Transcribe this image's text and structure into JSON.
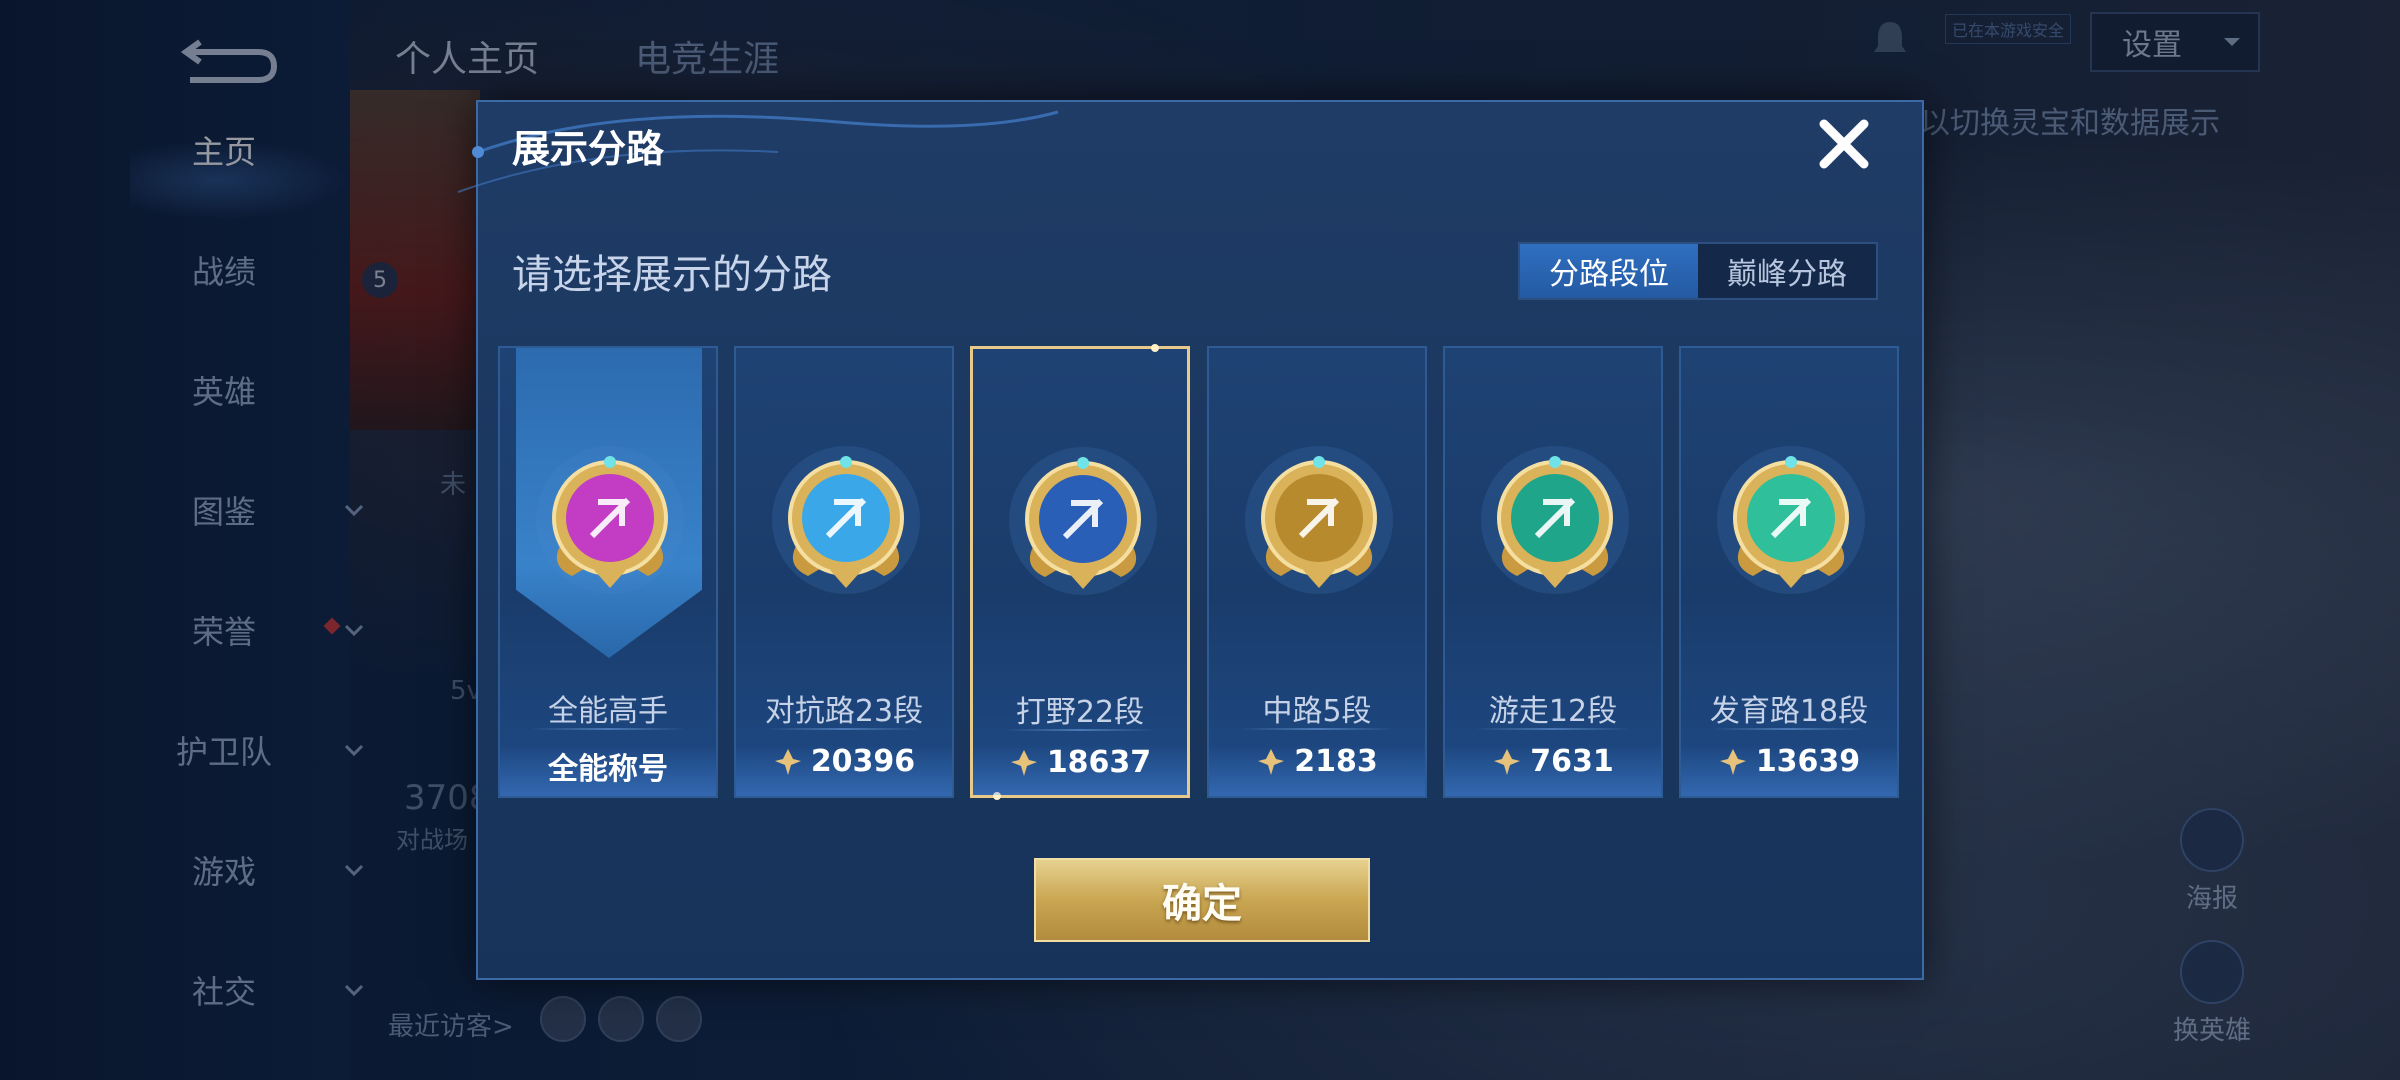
{
  "left_nav": {
    "items": [
      {
        "label": "主页",
        "active": true,
        "chevron": false
      },
      {
        "label": "战绩",
        "active": false,
        "chevron": false
      },
      {
        "label": "英雄",
        "active": false,
        "chevron": false
      },
      {
        "label": "图鉴",
        "active": false,
        "chevron": true
      },
      {
        "label": "荣誉",
        "active": false,
        "chevron": true
      },
      {
        "label": "护卫队",
        "active": false,
        "chevron": true
      },
      {
        "label": "游戏",
        "active": false,
        "chevron": true
      },
      {
        "label": "社交",
        "active": false,
        "chevron": true
      }
    ]
  },
  "top_tabs": [
    "个人主页",
    "电竞生涯"
  ],
  "header": {
    "settings_label": "设置",
    "online_tag": "已在本游戏安全",
    "bg_hint": "以切换灵宝和数据展示"
  },
  "background": {
    "badge_level": "5",
    "frag_1": "未",
    "frag_2": "5v",
    "frag_3": "3708",
    "frag_4": "对战场",
    "visitors_label": "最近访客>",
    "poster_label": "海报",
    "change_hero_label": "换英雄"
  },
  "modal": {
    "title": "展示分路",
    "subtitle": "请选择展示的分路",
    "toggle": [
      {
        "label": "分路段位",
        "active": true
      },
      {
        "label": "巅峰分路",
        "active": false
      }
    ],
    "cards": [
      {
        "name": "全能高手",
        "score": "全能称号",
        "has_score_icon": false,
        "selected": false,
        "emblem": "all-round-emblem-icon",
        "color": "#c23cc4"
      },
      {
        "name": "对抗路23段",
        "score": "20396",
        "has_score_icon": true,
        "selected": false,
        "emblem": "clash-lane-emblem-icon",
        "color": "#3aa8e8"
      },
      {
        "name": "打野22段",
        "score": "18637",
        "has_score_icon": true,
        "selected": true,
        "emblem": "jungle-emblem-icon",
        "color": "#2a5fb8"
      },
      {
        "name": "中路5段",
        "score": "2183",
        "has_score_icon": true,
        "selected": false,
        "emblem": "mid-lane-emblem-icon",
        "color": "#b88a2e"
      },
      {
        "name": "游走12段",
        "score": "7631",
        "has_score_icon": true,
        "selected": false,
        "emblem": "roam-emblem-icon",
        "color": "#1fa58a"
      },
      {
        "name": "发育路18段",
        "score": "13639",
        "has_score_icon": true,
        "selected": false,
        "emblem": "farm-lane-emblem-icon",
        "color": "#2fbf9a"
      }
    ],
    "confirm_label": "确定"
  },
  "colors": {
    "gold": "#e7c98a",
    "active_tab": "#2f6fc0",
    "modal_bg": "#1b3861"
  }
}
